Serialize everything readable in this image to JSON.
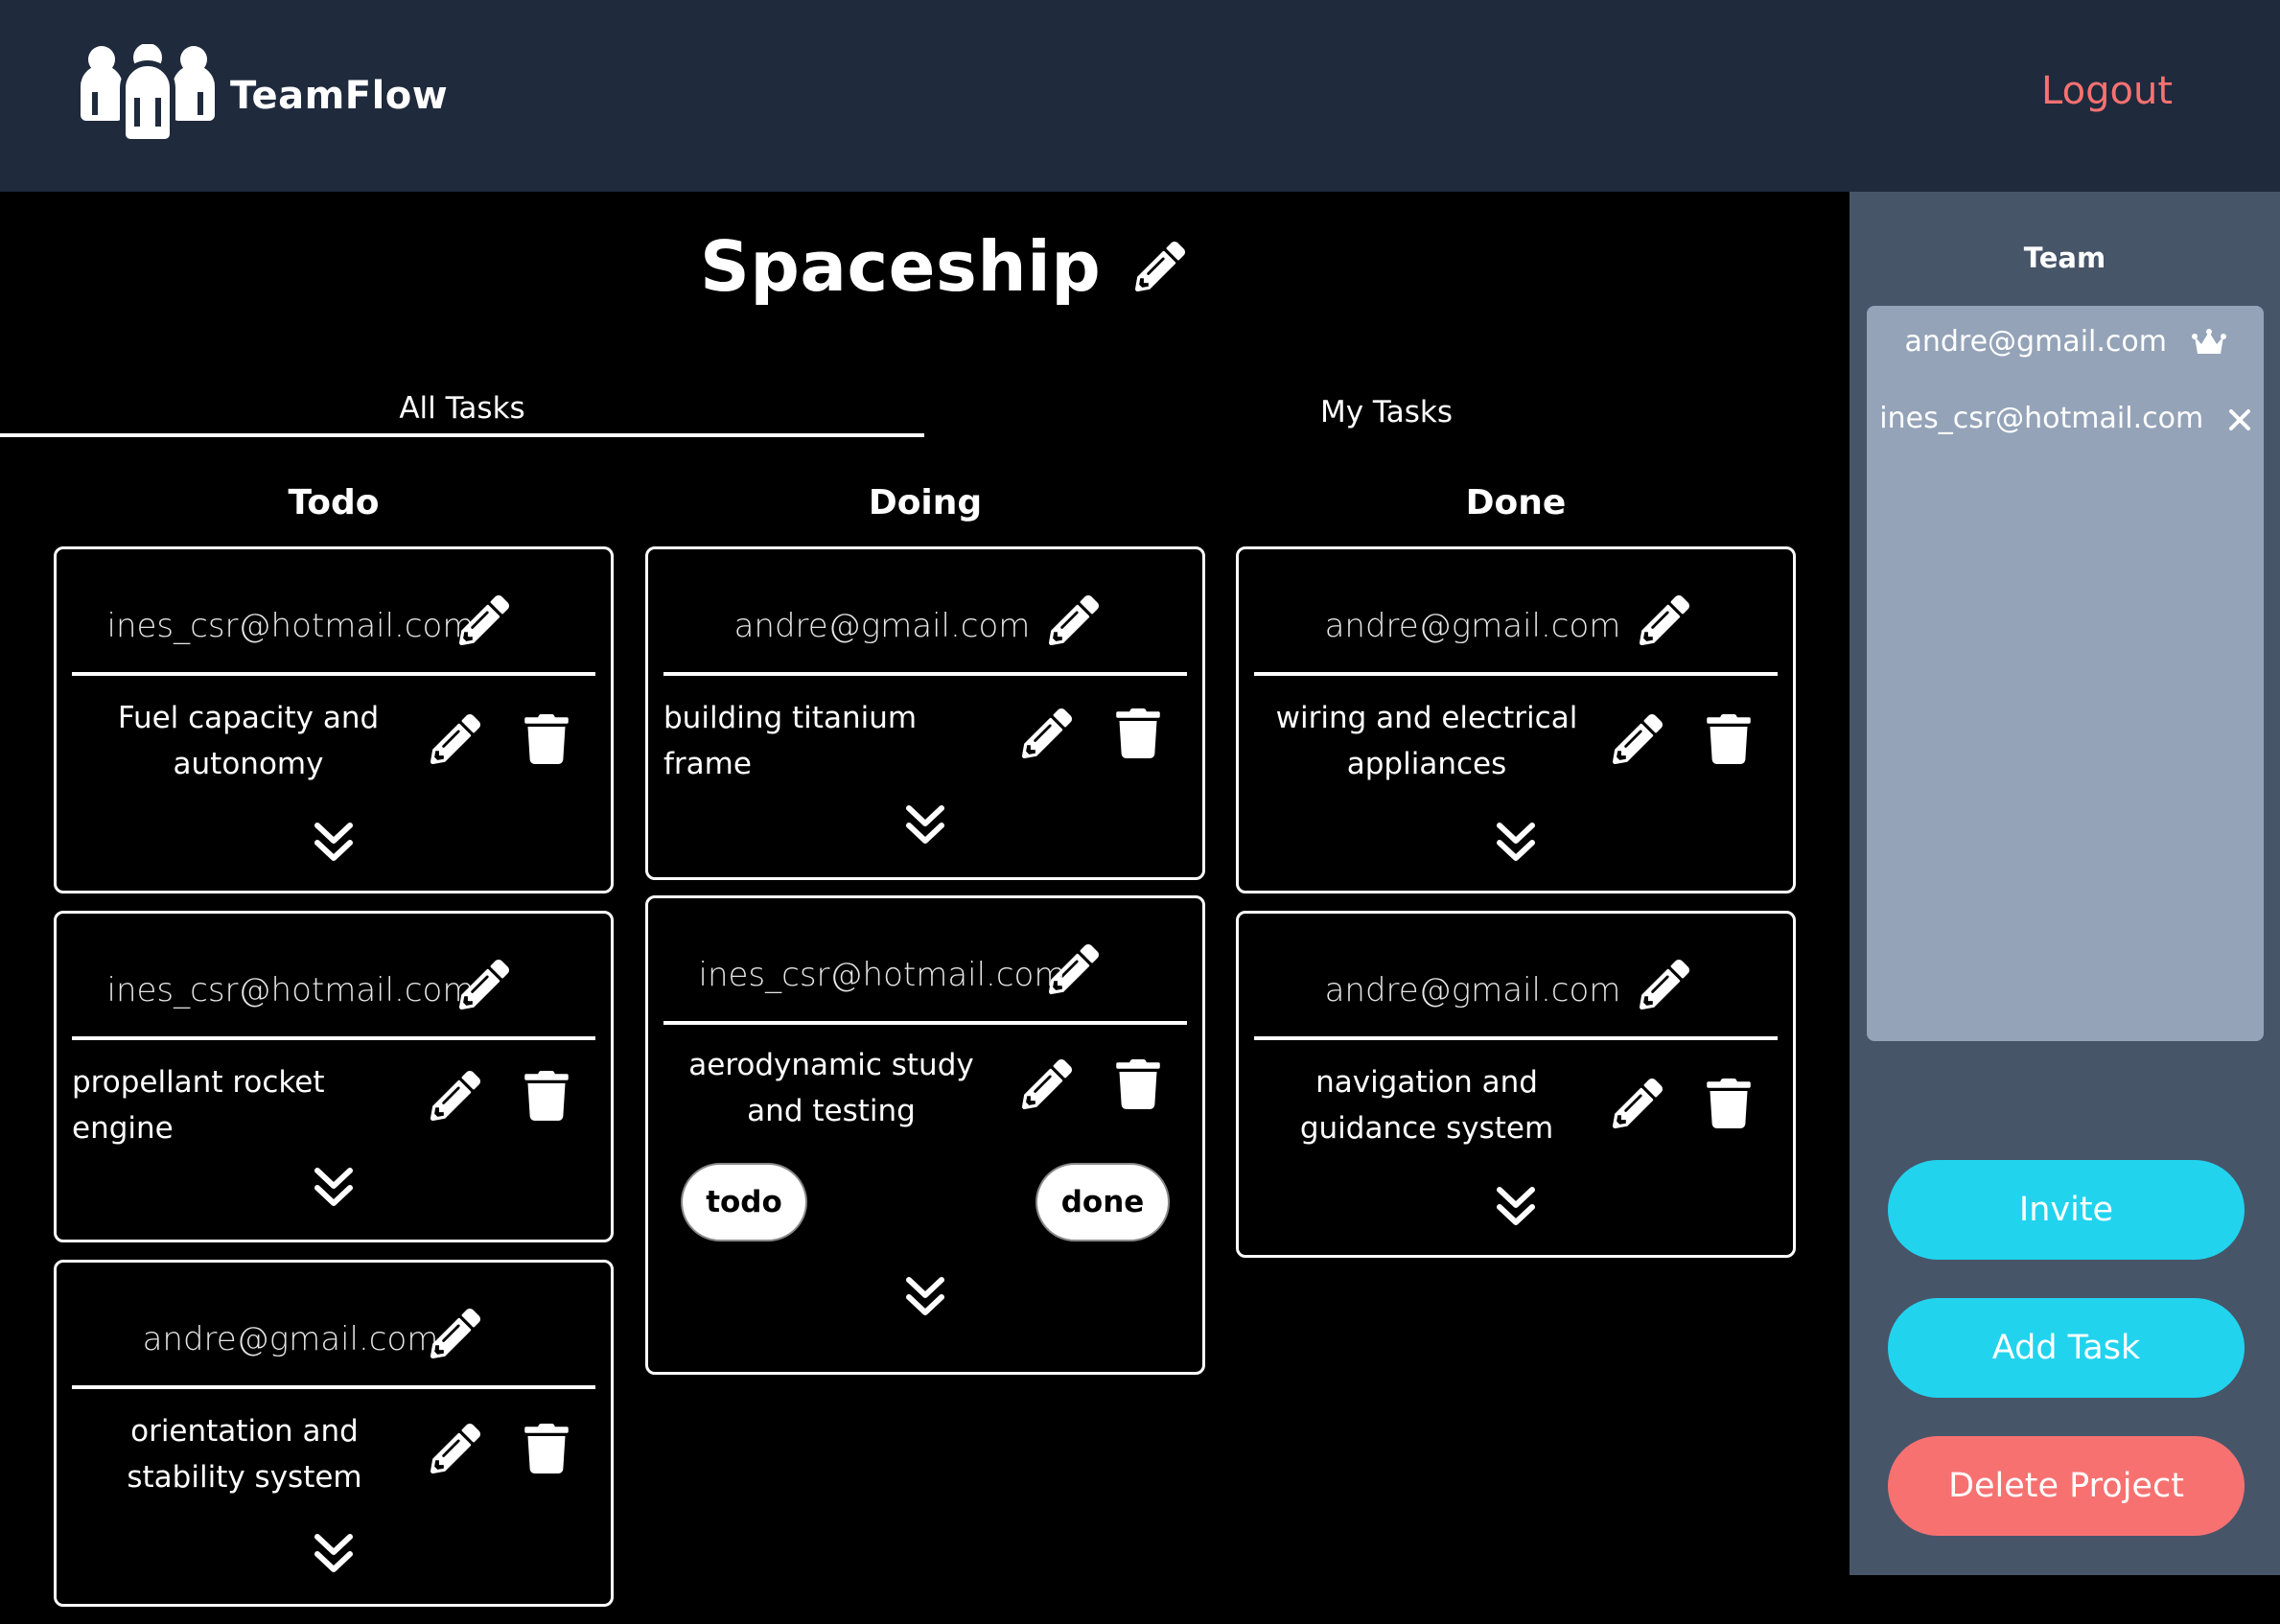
{
  "app": {
    "name": "TeamFlow",
    "logout_label": "Logout"
  },
  "project": {
    "title": "Spaceship"
  },
  "tabs": [
    {
      "label": "All Tasks",
      "active": true
    },
    {
      "label": "My Tasks",
      "active": false
    }
  ],
  "columns": [
    {
      "title": "Todo",
      "cards": [
        {
          "assignee": "ines_csr@hotmail.com",
          "title": "Fuel capacity and autonomy"
        },
        {
          "assignee": "ines_csr@hotmail.com",
          "title": "propellant rocket engine"
        },
        {
          "assignee": "andre@gmail.com",
          "title": "orientation and stability system"
        }
      ]
    },
    {
      "title": "Doing",
      "cards": [
        {
          "assignee": "andre@gmail.com",
          "title": "building titanium frame"
        },
        {
          "assignee": "ines_csr@hotmail.com",
          "title": "aerodynamic study and testing",
          "move_left": "todo",
          "move_right": "done"
        }
      ]
    },
    {
      "title": "Done",
      "cards": [
        {
          "assignee": "andre@gmail.com",
          "title": "wiring and electrical appliances"
        },
        {
          "assignee": "andre@gmail.com",
          "title": "navigation and guidance system"
        }
      ]
    }
  ],
  "team": {
    "title": "Team",
    "members": [
      {
        "email": "andre@gmail.com",
        "icon": "crown-icon"
      },
      {
        "email": "ines_csr@hotmail.com",
        "icon": "remove-icon"
      }
    ]
  },
  "actions": {
    "invite": "Invite",
    "add_task": "Add Task",
    "delete_project": "Delete Project"
  },
  "colors": {
    "header": "#1f2a3d",
    "sidebar": "#475569",
    "team_box": "#94a3b8",
    "accent": "#22d3ee",
    "danger": "#f87171"
  }
}
